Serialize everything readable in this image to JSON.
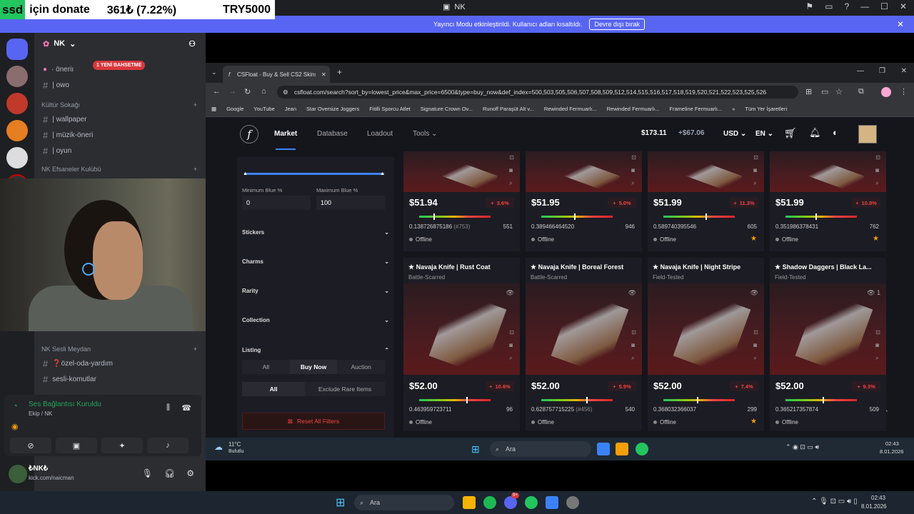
{
  "overlay": {
    "badge": "ssd",
    "text": "için donate",
    "amount": "361₺ (7.22%)",
    "target": "TRY5000"
  },
  "window": {
    "title": "NK"
  },
  "banner": {
    "text": "Yayıncı Modu etkinleştirildi. Kullanıcı adları kısaltıldı.",
    "button": "Devre dışı bırak"
  },
  "discord": {
    "server_name": "NK",
    "new_mention": "1 YENİ BAHSETME",
    "top_channels": [
      {
        "icon": "bubble-icon",
        "label": "· öneriı"
      },
      {
        "icon": "hash-icon",
        "label": "| owo"
      }
    ],
    "categories": [
      {
        "name": "Kültür Sokağı",
        "channels": [
          "| wallpaper",
          "| müzik-öneri",
          "| oyun"
        ]
      },
      {
        "name": "NK Efsaneler Kulübü"
      },
      {
        "name": "NK Sesli Meydan",
        "channels": [
          "❓özel-oda-yardım",
          "sesli-komutlar"
        ]
      }
    ],
    "voice": {
      "status": "Ses Bağlantısı Kuruldu",
      "channel": "Ekip / NK"
    },
    "user": {
      "name": "₺NK₺",
      "status": "kick.com/naicman"
    }
  },
  "browser": {
    "tab_title": "CSFloat - Buy & Sell CS2 Skins",
    "url": "csfloat.com/search?sort_by=lowest_price&max_price=6500&type=buy_now&def_index=500,503,505,506,507,508,509,512,514,515,516,517,518,519,520,521,522,523,525,526",
    "bookmarks": [
      "Google",
      "YouTube",
      "Jean",
      "Star Oversize Joggers",
      "Fitilli Sporcu Atlet",
      "Signature Crown Ov...",
      "Runoff Paraşüt Alt v...",
      "Rewinded Fermuarlı...",
      "Rewinded Fermuarlı...",
      "Frameline Fermuarlı...",
      "Tüm Yer İşaretleri"
    ]
  },
  "csfloat": {
    "nav": [
      "Market",
      "Database",
      "Loadout",
      "Tools"
    ],
    "balance": "$173.11",
    "pending": "+$67.06",
    "currency": "USD",
    "language": "EN",
    "filters": {
      "min_blue_label": "Minimum Blue %",
      "max_blue_label": "Maximum Blue %",
      "min_blue": "0",
      "max_blue": "100",
      "sections": [
        "Stickers",
        "Charms",
        "Rarity",
        "Collection",
        "Listing"
      ],
      "listing_types": [
        "All",
        "Buy Now",
        "Auction"
      ],
      "rare_toggle": [
        "All",
        "Exclude Rare Items"
      ],
      "reset": "Reset All Filters"
    },
    "row1": [
      {
        "price": "$51.94",
        "pct": "3.6%",
        "float": "0.138726875186",
        "pattern": "(#753)",
        "num": "551",
        "status": "Offline",
        "fav": false,
        "tick": 0.2
      },
      {
        "price": "$51.95",
        "pct": "5.0%",
        "float": "0.389466464520",
        "pattern": "",
        "num": "946",
        "status": "Offline",
        "fav": false,
        "tick": 0.46
      },
      {
        "price": "$51.99",
        "pct": "11.3%",
        "float": "0.589740395546",
        "pattern": "",
        "num": "605",
        "status": "Offline",
        "fav": true,
        "tick": 0.59
      },
      {
        "price": "$51.99",
        "pct": "10.8%",
        "float": "0.351986378431",
        "pattern": "",
        "num": "762",
        "status": "Offline",
        "fav": true,
        "tick": 0.42
      }
    ],
    "row2": [
      {
        "name": "★ Navaja Knife | Rust Coat",
        "cond": "Battle-Scarred",
        "price": "$52.00",
        "pct": "10.6%",
        "float": "0.463959723711",
        "pattern": "",
        "num": "96",
        "status": "Offline",
        "fav": false,
        "views": "",
        "tick": 0.66
      },
      {
        "name": "★ Navaja Knife | Boreal Forest",
        "cond": "Battle-Scarred",
        "price": "$52.00",
        "pct": "5.9%",
        "float": "0.628757715225",
        "pattern": "(#456)",
        "num": "540",
        "status": "Offline",
        "fav": false,
        "views": "",
        "tick": 0.63
      },
      {
        "name": "★ Navaja Knife | Night Stripe",
        "cond": "Field-Tested",
        "price": "$52.00",
        "pct": "7.4%",
        "float": "0.368032366037",
        "pattern": "",
        "num": "299",
        "status": "Offline",
        "fav": true,
        "views": "",
        "tick": 0.47
      },
      {
        "name": "★ Shadow Daggers | Black La...",
        "cond": "Field-Tested",
        "price": "$52.00",
        "pct": "9.3%",
        "float": "0.365217357874",
        "pattern": "",
        "num": "509",
        "status": "Offline",
        "fav": false,
        "views": "1",
        "tick": 0.52
      }
    ]
  },
  "inner_taskbar": {
    "temp": "11°C",
    "weather": "Bulutlu",
    "search": "Ara",
    "time": "02:43",
    "date": "8.01.2026"
  },
  "taskbar": {
    "search": "Ara",
    "time": "02:43",
    "date": "8.01.2026",
    "chat_badge": "9+"
  }
}
